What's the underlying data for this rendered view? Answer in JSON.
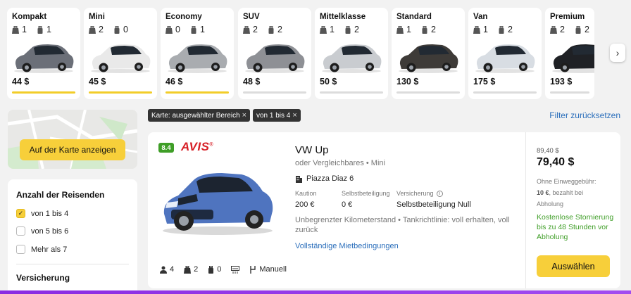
{
  "categories": [
    {
      "name": "Kompakt",
      "bags_large": "1",
      "bags_small": "1",
      "price": "44 $",
      "active": true,
      "color": "#6b6f78"
    },
    {
      "name": "Mini",
      "bags_large": "2",
      "bags_small": "0",
      "price": "45 $",
      "active": true,
      "color": "#e9e9e9"
    },
    {
      "name": "Economy",
      "bags_large": "0",
      "bags_small": "1",
      "price": "46 $",
      "active": true,
      "color": "#a9acb0"
    },
    {
      "name": "SUV",
      "bags_large": "2",
      "bags_small": "2",
      "price": "48 $",
      "active": false,
      "color": "#8e9095"
    },
    {
      "name": "Mittelklasse",
      "bags_large": "1",
      "bags_small": "2",
      "price": "50 $",
      "active": false,
      "color": "#c9ccd0"
    },
    {
      "name": "Standard",
      "bags_large": "1",
      "bags_small": "2",
      "price": "130 $",
      "active": false,
      "color": "#3e3b38"
    },
    {
      "name": "Van",
      "bags_large": "1",
      "bags_small": "2",
      "price": "175 $",
      "active": false,
      "color": "#d8dde3"
    },
    {
      "name": "Premium",
      "bags_large": "2",
      "bags_small": "2",
      "price": "193 $",
      "active": false,
      "color": "#1f2125"
    }
  ],
  "map": {
    "button_label": "Auf der Karte anzeigen"
  },
  "filters": {
    "passengers_title": "Anzahl der Reisenden",
    "options": [
      {
        "label": "von 1 bis 4",
        "checked": true
      },
      {
        "label": "von 5 bis 6",
        "checked": false
      },
      {
        "label": "Mehr als 7",
        "checked": false
      }
    ],
    "insurance_title": "Versicherung"
  },
  "chips": [
    {
      "label": "Karte: ausgewählter Bereich",
      "close": "×"
    },
    {
      "label": "von 1 bis 4",
      "close": "×"
    }
  ],
  "reset_label": "Filter zurücksetzen",
  "offer": {
    "rating": "8.4",
    "brand": "AVIS",
    "brand_mark": "®",
    "title": "VW Up",
    "subtitle": "oder Vergleichbares • Mini",
    "location": "Piazza Diaz 6",
    "deposit_label": "Kaution",
    "deposit_value": "200 €",
    "excess_label": "Selbstbeteiligung",
    "excess_value": "0 €",
    "insurance_label": "Versicherung",
    "insurance_info": "i",
    "insurance_value": "Selbstbeteiligung Null",
    "features": "Unbegrenzter Kilometerstand • Tankrichtlinie: voll erhalten, voll zurück",
    "terms_link": "Vollständige Mietbedingungen",
    "seats": "4",
    "bags_large": "2",
    "bags_small": "0",
    "transmission": "Manuell",
    "old_price": "89,40 $",
    "price": "79,40 $",
    "fee_line1": "Ohne Einweggebühr:",
    "fee_amount": "10 €",
    "fee_line2": ", bezahlt bei",
    "fee_line3": "Abholung",
    "cancellation": "Kostenlose Stornierung bis zu 48 Stunden vor Abholung",
    "select_label": "Auswählen"
  }
}
